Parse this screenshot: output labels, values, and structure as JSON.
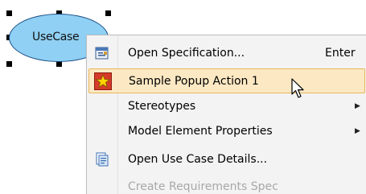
{
  "diagram": {
    "usecase_label": "UseCase"
  },
  "context_menu": {
    "items": [
      {
        "label": "Open Specification...",
        "shortcut": "Enter",
        "icon": "specification-icon",
        "state": "normal"
      },
      {
        "label": "Sample Popup Action 1",
        "shortcut": "",
        "icon": "star-icon",
        "state": "hover"
      },
      {
        "label": "Stereotypes",
        "shortcut": "",
        "icon": "",
        "state": "normal",
        "submenu": true
      },
      {
        "label": "Model Element Properties",
        "shortcut": "",
        "icon": "",
        "state": "normal",
        "submenu": true
      },
      {
        "label": "Open Use Case Details...",
        "shortcut": "",
        "icon": "use-case-details-icon",
        "state": "normal"
      },
      {
        "label": "Create Requirements Spec",
        "shortcut": "",
        "icon": "",
        "state": "disabled"
      }
    ]
  },
  "colors": {
    "usecase_fill": "#8fd0f4",
    "hover_fill": "#fce9c4",
    "hover_border": "#e8b65a",
    "star_box": "#d63a2a",
    "star": "#ffd400"
  }
}
